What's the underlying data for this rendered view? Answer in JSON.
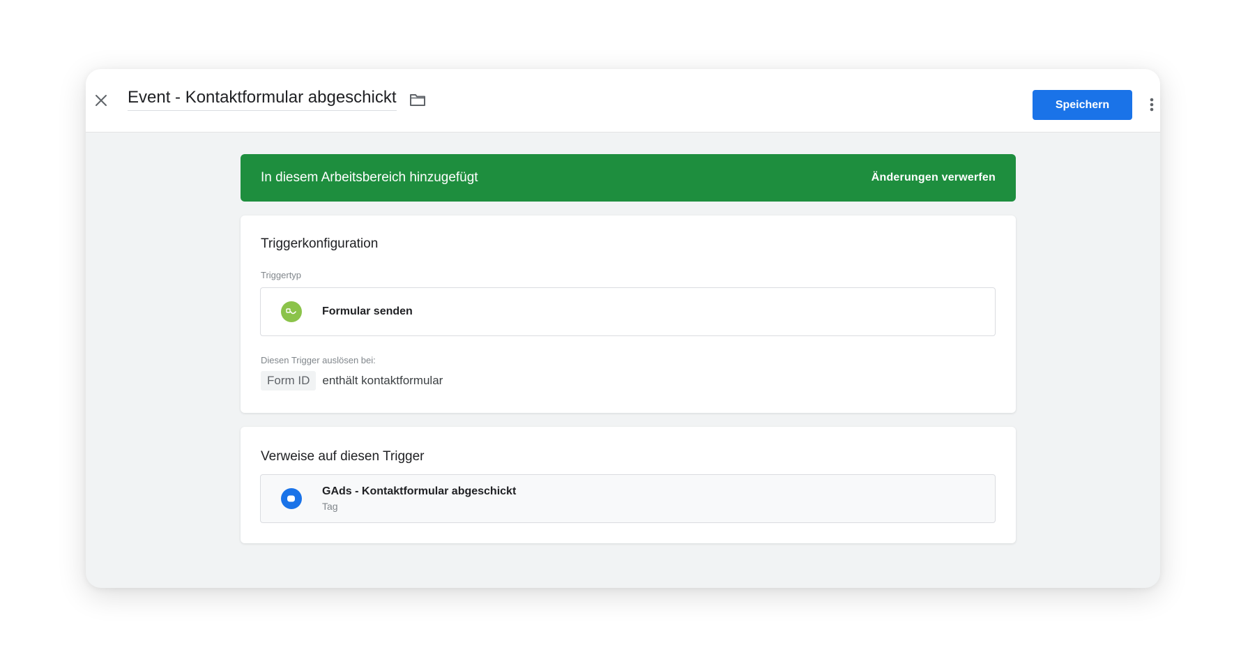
{
  "header": {
    "title": "Event - Kontaktformular abgeschickt",
    "save_label": "Speichern",
    "icons": {
      "close": "close-icon",
      "folder": "folder-icon",
      "more": "more-vert-icon"
    }
  },
  "banner": {
    "text": "In diesem Arbeitsbereich hinzugefügt",
    "action_label": "Änderungen verwerfen"
  },
  "trigger_config": {
    "title": "Triggerkonfiguration",
    "type_label": "Triggertyp",
    "type_value": "Formular senden",
    "fire_on_label": "Diesen Trigger auslösen bei:",
    "condition_variable": "Form ID",
    "condition_text": "enthält kontaktformular"
  },
  "references": {
    "title": "Verweise auf diesen Trigger",
    "items": [
      {
        "name": "GAds - Kontaktformular abgeschickt",
        "type": "Tag"
      }
    ]
  },
  "colors": {
    "accent": "#1a73e8",
    "banner": "#1e8e3e",
    "trigger_icon": "#8bc34a",
    "tag_icon": "#1a73e8"
  }
}
